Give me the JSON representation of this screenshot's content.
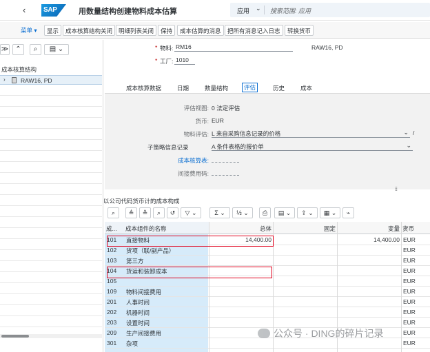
{
  "shell": {
    "back_icon": "‹",
    "logo_text": "SAP",
    "title": "用数量结构创建物料成本估算",
    "search_scope": "应用",
    "search_placeholder": "搜索范围: 应用"
  },
  "toolbar": {
    "menu": "菜单 ▾",
    "buttons": [
      "显示",
      "成本核算结构关闭",
      "明细列表关闭",
      "保持",
      "成本估算的消息",
      "把所有消息记入日志",
      "转换货币"
    ]
  },
  "tree": {
    "header": "成本核算结构",
    "node_label": "RAW16, PD"
  },
  "header_fields": {
    "material_label": "物料:",
    "material_value": "RM16",
    "material_desc": "RAW16, PD",
    "plant_label": "工厂:",
    "plant_value": "1010"
  },
  "tabs": [
    "成本核算数据",
    "日期",
    "数量结构",
    "评估",
    "历史",
    "成本"
  ],
  "active_tab": "评估",
  "valuation": {
    "view_label": "评估视图:",
    "view_value": "0 法定评估",
    "currency_label": "货币:",
    "currency_value": "EUR",
    "mat_val_label": "物料评估:",
    "mat_val_value": "L 来自采购信息记录的价格",
    "sub_strategy_label": "子策略信息记录",
    "sub_strategy_value": "A 条件表格的报价单",
    "costing_sheet_label": "成本核算表:",
    "overhead_label": "间接费用码:"
  },
  "section_title": "以公司代码货币计的成本构成",
  "grid": {
    "columns": [
      "成...",
      "成本组件的名称",
      "总体",
      "固定",
      "变量",
      "货币"
    ],
    "rows": [
      {
        "code": "101",
        "name": "直接物料",
        "total": "14,400.00",
        "fixed": "",
        "variable": "14,400.00",
        "currency": "EUR"
      },
      {
        "code": "102",
        "name": "货项（联/副产品）",
        "total": "",
        "fixed": "",
        "variable": "",
        "currency": "EUR"
      },
      {
        "code": "103",
        "name": "第三方",
        "total": "",
        "fixed": "",
        "variable": "",
        "currency": "EUR"
      },
      {
        "code": "104",
        "name": "货运和装卸成本",
        "total": "",
        "fixed": "",
        "variable": "",
        "currency": "EUR"
      },
      {
        "code": "105",
        "name": "",
        "total": "",
        "fixed": "",
        "variable": "",
        "currency": "EUR"
      },
      {
        "code": "109",
        "name": "物料间接费用",
        "total": "",
        "fixed": "",
        "variable": "",
        "currency": "EUR"
      },
      {
        "code": "201",
        "name": "人事时间",
        "total": "",
        "fixed": "",
        "variable": "",
        "currency": "EUR"
      },
      {
        "code": "202",
        "name": "机器时间",
        "total": "",
        "fixed": "",
        "variable": "",
        "currency": "EUR"
      },
      {
        "code": "203",
        "name": "设置时间",
        "total": "",
        "fixed": "",
        "variable": "",
        "currency": "EUR"
      },
      {
        "code": "209",
        "name": "生产间接费用",
        "total": "",
        "fixed": "",
        "variable": "",
        "currency": "EUR"
      },
      {
        "code": "301",
        "name": "杂项",
        "total": "",
        "fixed": "",
        "variable": "",
        "currency": "EUR"
      }
    ]
  },
  "watermark": "公众号 · DING的碎片记录",
  "colors": {
    "accent": "#0a6ed1",
    "highlight_border": "#e0001b",
    "key_column": "#d6ebfa"
  }
}
